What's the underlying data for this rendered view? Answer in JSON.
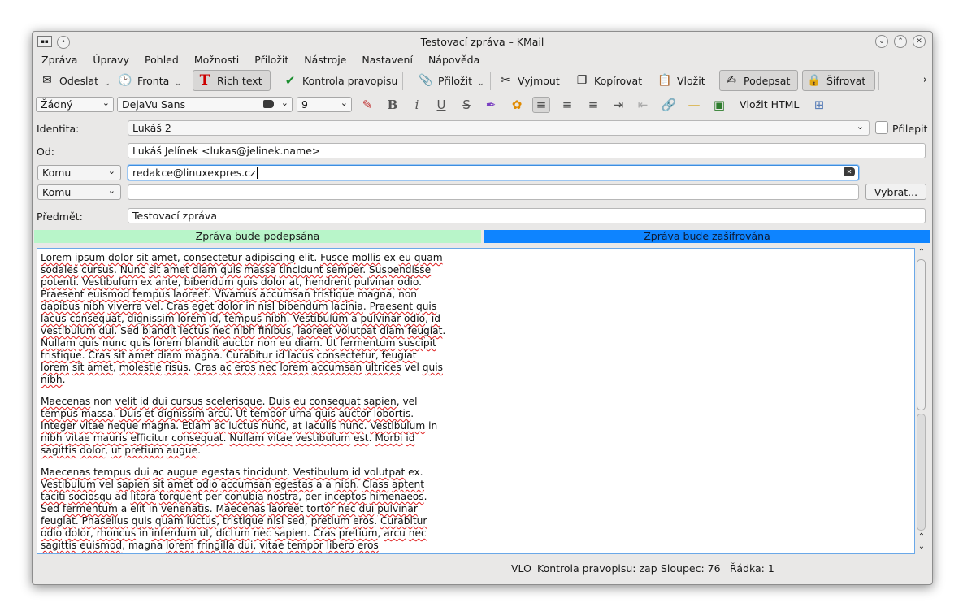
{
  "window": {
    "title": "Testovací zpráva – KMail"
  },
  "menubar": [
    "Zpráva",
    "Úpravy",
    "Pohled",
    "Možnosti",
    "Přiložit",
    "Nástroje",
    "Nastavení",
    "Nápověda"
  ],
  "toolbar": {
    "send": "Odeslat",
    "queue": "Fronta",
    "rich_text": "Rich text",
    "spellcheck": "Kontrola pravopisu",
    "attach": "Přiložit",
    "cut": "Vyjmout",
    "copy": "Kopírovat",
    "paste": "Vložit",
    "sign": "Podepsat",
    "encrypt": "Šifrovat",
    "more": "›"
  },
  "formatbar": {
    "style": "Žádný",
    "font": "DejaVu Sans",
    "size": "9",
    "insert_html": "Vložit HTML"
  },
  "headers": {
    "identity_label": "Identita:",
    "identity_value": "Lukáš 2",
    "sticky_label": "Přilepit",
    "from_label": "Od:",
    "from_value": "Lukáš Jelínek <lukas@jelinek.name>",
    "recipients": [
      {
        "type": "Komu",
        "value": "redakce@linuxexpres.cz"
      },
      {
        "type": "Komu",
        "value": ""
      }
    ],
    "select_button": "Vybrat...",
    "subject_label": "Předmět:",
    "subject_value": "Testovací zpráva"
  },
  "crypto_status": {
    "sign": "Zpráva bude podepsána",
    "encrypt": "Zpráva bude zašifrována",
    "sign_color": "#b8f5c9",
    "encrypt_color": "#0e84ff"
  },
  "statusbar": {
    "mode": "VLO",
    "spellcheck": "Kontrola pravopisu: zap",
    "column": "Sloupec: 76",
    "row": "Řádka: 1"
  }
}
